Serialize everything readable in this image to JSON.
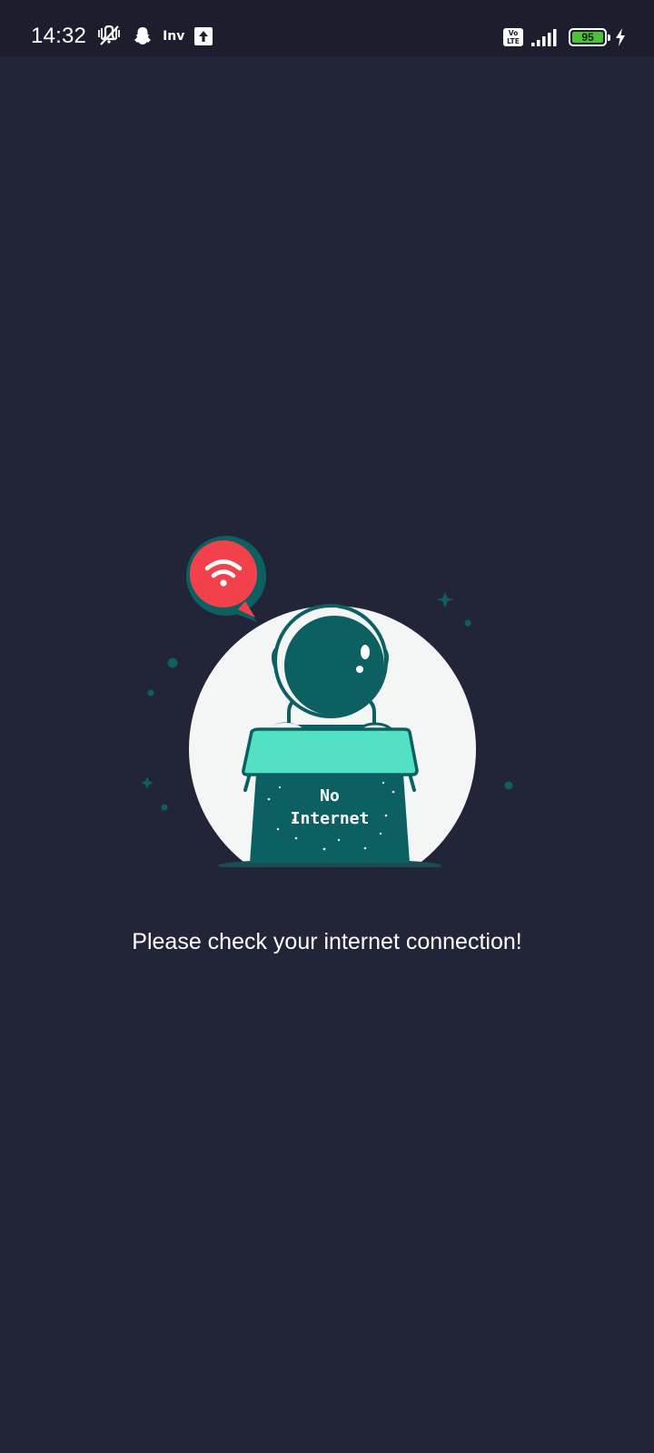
{
  "status_bar": {
    "time": "14:32",
    "notification_icons": [
      "mute-vibrate-icon",
      "snapchat-ghost-icon",
      "inv-app-icon",
      "upload-arrow-icon"
    ],
    "inv_label": "Inv",
    "volte_top": "Vo",
    "volte_bottom": "LTE",
    "battery_level": "95",
    "charging": true
  },
  "illustration": {
    "desk_text_line1": "No",
    "desk_text_line2": "Internet",
    "icon": "wifi-off-bubble-icon",
    "colors": {
      "circle": "#f4f6f6",
      "teal_dark": "#0d6062",
      "teal_light": "#52e2c3",
      "bubble_red": "#f2414a"
    }
  },
  "main": {
    "message": "Please check your internet connection!"
  }
}
